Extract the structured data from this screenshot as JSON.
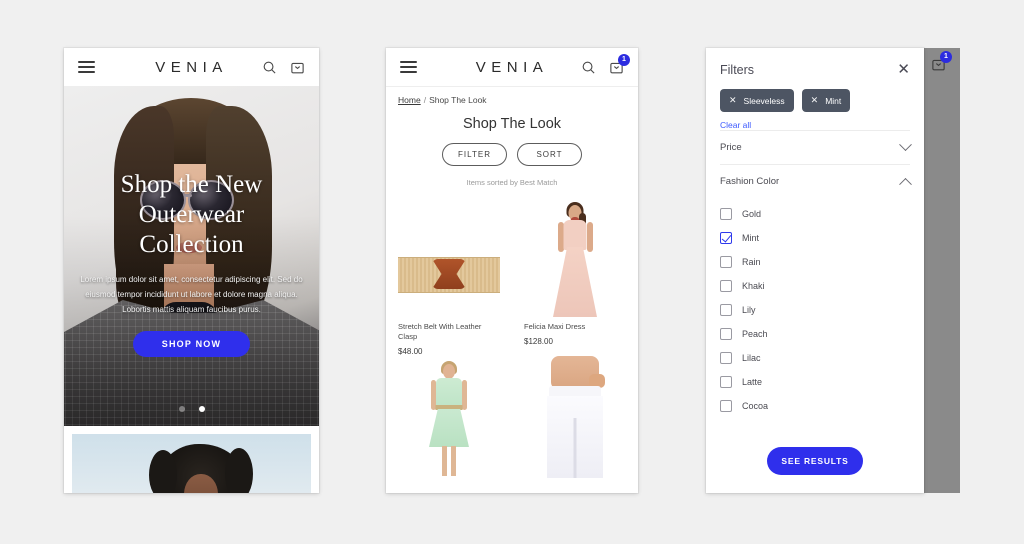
{
  "brand": "VENIA",
  "icons": {
    "menu": "hamburger-icon",
    "search": "search-icon",
    "cart": "cart-icon",
    "close": "close-icon",
    "chevron_down": "chevron-down-icon",
    "chevron_up": "chevron-up-icon"
  },
  "phone1": {
    "cart_badge": "",
    "hero": {
      "title_line1": "Shop the New",
      "title_line2": "Outerwear",
      "title_line3": "Collection",
      "body": "Lorem ipsum dolor sit amet, consectetur adipiscing elit. Sed do eiusmod tempor incididunt ut labore et dolore magna aliqua. Lobortis mattis aliquam faucibus purus.",
      "cta": "SHOP NOW",
      "accent_color": "#2f2fec",
      "slides": 2,
      "active_slide": 2
    }
  },
  "phone2": {
    "cart_badge": "1",
    "breadcrumb": {
      "home": "Home",
      "separator": "/",
      "current": "Shop The Look"
    },
    "page_title": "Shop The Look",
    "filter_button": "FILTER",
    "sort_button": "SORT",
    "sort_note": "Items sorted by Best Match",
    "products": [
      {
        "name": "Stretch Belt With Leather Clasp",
        "price": "$48.00"
      },
      {
        "name": "Felicia Maxi Dress",
        "price": "$128.00"
      },
      {
        "name": "",
        "price": ""
      },
      {
        "name": "",
        "price": ""
      }
    ]
  },
  "phone3": {
    "cart_badge": "1",
    "title": "Filters",
    "close_label": "✕",
    "chips": [
      {
        "label": "Sleeveless",
        "remove": "✕"
      },
      {
        "label": "Mint",
        "remove": "✕"
      }
    ],
    "clear_all": "Clear all",
    "sections": [
      {
        "label": "Price",
        "expanded": false
      },
      {
        "label": "Fashion Color",
        "expanded": true
      }
    ],
    "colors": [
      {
        "label": "Gold",
        "checked": false
      },
      {
        "label": "Mint",
        "checked": true
      },
      {
        "label": "Rain",
        "checked": false
      },
      {
        "label": "Khaki",
        "checked": false
      },
      {
        "label": "Lily",
        "checked": false
      },
      {
        "label": "Peach",
        "checked": false
      },
      {
        "label": "Lilac",
        "checked": false
      },
      {
        "label": "Latte",
        "checked": false
      },
      {
        "label": "Cocoa",
        "checked": false
      }
    ],
    "see_results": "SEE RESULTS",
    "accent_color": "#2f2fec",
    "chip_color": "#4d5563",
    "link_color": "#3d5afe"
  }
}
